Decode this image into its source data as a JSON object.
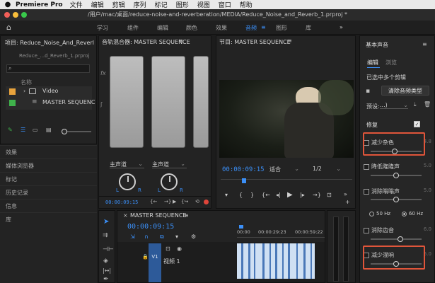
{
  "menubar": {
    "apple": "",
    "app": "Premiere Pro",
    "items": [
      "文件",
      "编辑",
      "剪辑",
      "序列",
      "标记",
      "图形",
      "视图",
      "窗口",
      "帮助"
    ]
  },
  "window": {
    "title": "/用户/mac/桌面/reduce-noise-and-reverberation/MEDIA/Reduce_Noise_and_Reverb_1.prproj *"
  },
  "workspaces": {
    "items": [
      "学习",
      "组件",
      "编辑",
      "颜色",
      "效果",
      "音频",
      "图形",
      "库"
    ],
    "active": "音频",
    "more": "»"
  },
  "project": {
    "title": "项目: Reduce_Noise_And_Reverl",
    "file": "Reduce_...d_Reverb_1.prproj",
    "name_header": "名称",
    "items": [
      {
        "name": "Video",
        "color": "#e8a33c"
      },
      {
        "name": "MASTER SEQUENC",
        "color": "#3fb24b"
      }
    ]
  },
  "side_panels": [
    "效果",
    "媒体浏览器",
    "标记",
    "历史记录",
    "信息",
    "库"
  ],
  "mixer": {
    "title": "音轨混合器: MASTER SEQUENCE",
    "channel_label": "主声道",
    "l": "L",
    "r": "R",
    "timecode": "00:00:09:15"
  },
  "program": {
    "title": "节目: MASTER SEQUENCE",
    "timecode": "00:00:09:15",
    "fit": "适合",
    "resolution": "1/2"
  },
  "timeline": {
    "title": "MASTER SEQUENCE",
    "timecode": "00:00:09:15",
    "ruler": [
      "00:00",
      "00:00:29:23",
      "00:00:59:22"
    ],
    "track": "V1",
    "track_name": "视频 1"
  },
  "essential_sound": {
    "title": "基本声音",
    "tabs": [
      "编辑",
      "浏览"
    ],
    "active_tab": "编辑",
    "selected": "已选中多个剪辑",
    "clear_button": "清除音频类型",
    "preset_label": "预设:",
    "preset_value": "...)",
    "repair": "修复",
    "options": [
      {
        "label": "减少杂色",
        "value": "4.8",
        "checked": false,
        "level": 0.48,
        "highlighted": true
      },
      {
        "label": "降低隆隆声",
        "value": "5.0",
        "checked": false,
        "level": 0.5,
        "highlighted": false
      },
      {
        "label": "消除嗡嗡声",
        "value": "5.0",
        "checked": false,
        "level": 0.5,
        "highlighted": false
      },
      {
        "label": "消除齿音",
        "value": "6.0",
        "checked": false,
        "level": 0.6,
        "highlighted": false
      },
      {
        "label": "减少混响",
        "value": "5.0",
        "checked": false,
        "level": 0.5,
        "highlighted": true
      }
    ],
    "hz": [
      "50 Hz",
      "60 Hz"
    ]
  }
}
